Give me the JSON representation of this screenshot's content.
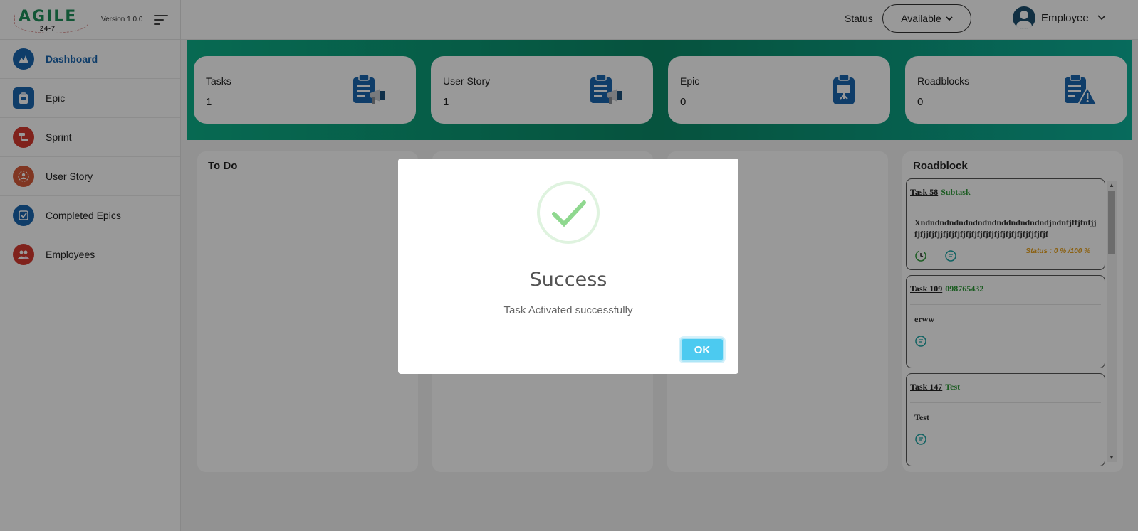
{
  "app": {
    "logo_text": "AGILE",
    "logo_sub": "24-7",
    "version": "Version 1.0.0"
  },
  "sidebar": {
    "items": [
      {
        "label": "Dashboard",
        "icon": "dashboard-icon",
        "color": "#1a66b0",
        "active": true
      },
      {
        "label": "Epic",
        "icon": "epic-icon",
        "color": "#1a66b0"
      },
      {
        "label": "Sprint",
        "icon": "sprint-icon",
        "color": "#d63a2f"
      },
      {
        "label": "User Story",
        "icon": "user-story-icon",
        "color": "#d65a3a"
      },
      {
        "label": "Completed Epics",
        "icon": "completed-epics-icon",
        "color": "#1a66b0"
      },
      {
        "label": "Employees",
        "icon": "employees-icon",
        "color": "#d63a2f"
      }
    ]
  },
  "header": {
    "status_label": "Status",
    "status_value": "Available",
    "user_name": "Employee"
  },
  "stats": [
    {
      "label": "Tasks",
      "value": "1",
      "icon": "tasks-megaphone-icon"
    },
    {
      "label": "User Story",
      "value": "1",
      "icon": "user-story-megaphone-icon"
    },
    {
      "label": "Epic",
      "value": "0",
      "icon": "epic-presentation-icon"
    },
    {
      "label": "Roadblocks",
      "value": "0",
      "icon": "roadblocks-warning-icon"
    }
  ],
  "columns": {
    "todo_title": "To Do",
    "roadblock_title": "Roadblock"
  },
  "roadblocks": [
    {
      "task": "Task 58",
      "tag": "Subtask",
      "desc": "Xndndndndndndndndnddndndndndjndnfjffjfnfjjfjfjjfjfjjfjfjfjfjfjfjfjfjfjfjfjfjfjfjfjfjfjfjf",
      "status": "Status : 0 % /100 %"
    },
    {
      "task": "Task 109",
      "tag": "098765432",
      "desc": "erww"
    },
    {
      "task": "Task 147",
      "tag": "Test",
      "desc": "Test"
    }
  ],
  "modal": {
    "title": "Success",
    "message": "Task Activated successfully",
    "ok_label": "OK",
    "icon": "success-check-icon"
  },
  "colors": {
    "accent": "#1a66b0",
    "banner_start": "#0cb089",
    "ok_button": "#4ccaf0",
    "status_text": "#e8a21f",
    "tag_green": "#2e9a38"
  }
}
